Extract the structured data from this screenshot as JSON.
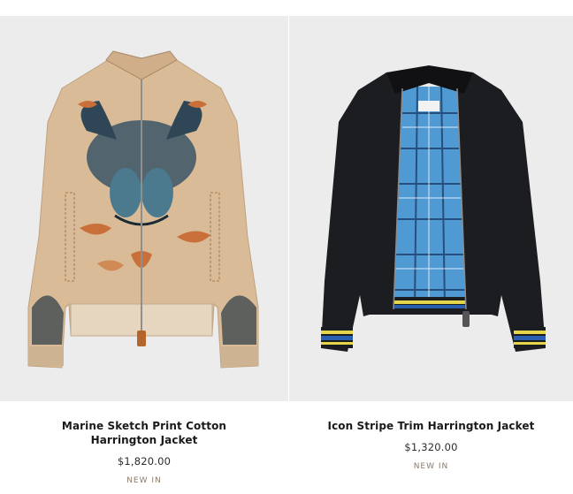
{
  "products": [
    {
      "title": "Marine Sketch Print Cotton Harrington Jacket",
      "price": "$1,820.00",
      "badge": "NEW IN",
      "image_icon": "beige-printed-harrington-jacket-image",
      "colors": {
        "body": "#d9bb98",
        "print": "#2e4656",
        "accent": "#c9703a"
      }
    },
    {
      "title": "Icon Stripe Trim Harrington Jacket",
      "price": "$1,320.00",
      "badge": "NEW IN",
      "image_icon": "black-harrington-jacket-check-lining-image",
      "colors": {
        "body": "#1c1d21",
        "lining": "#4f9ad3",
        "trim_yellow": "#e4d54a",
        "trim_blue": "#2a5fb0"
      }
    }
  ],
  "page_background": "#ececec"
}
